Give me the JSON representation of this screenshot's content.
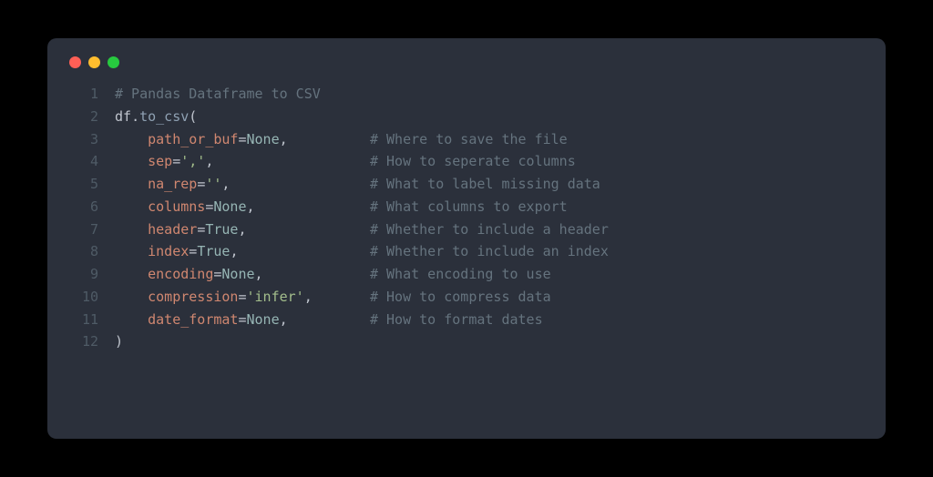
{
  "window": {
    "controls": [
      "close",
      "minimize",
      "maximize"
    ]
  },
  "code": {
    "lines": [
      {
        "num": "1",
        "tokens": [
          {
            "cls": "tok-comment",
            "text": "# Pandas Dataframe to CSV"
          }
        ]
      },
      {
        "num": "2",
        "tokens": [
          {
            "cls": "tok-ident",
            "text": "df"
          },
          {
            "cls": "tok-punct",
            "text": "."
          },
          {
            "cls": "tok-func",
            "text": "to_csv"
          },
          {
            "cls": "tok-punct",
            "text": "("
          }
        ]
      },
      {
        "num": "3",
        "tokens": [
          {
            "cls": "tok-punct",
            "text": "    "
          },
          {
            "cls": "tok-param",
            "text": "path_or_buf"
          },
          {
            "cls": "tok-op",
            "text": "="
          },
          {
            "cls": "tok-none",
            "text": "None"
          },
          {
            "cls": "tok-punct",
            "text": ",          "
          },
          {
            "cls": "tok-comment",
            "text": "# Where to save the file"
          }
        ]
      },
      {
        "num": "4",
        "tokens": [
          {
            "cls": "tok-punct",
            "text": "    "
          },
          {
            "cls": "tok-param",
            "text": "sep"
          },
          {
            "cls": "tok-op",
            "text": "="
          },
          {
            "cls": "tok-str",
            "text": "','"
          },
          {
            "cls": "tok-punct",
            "text": ",                   "
          },
          {
            "cls": "tok-comment",
            "text": "# How to seperate columns"
          }
        ]
      },
      {
        "num": "5",
        "tokens": [
          {
            "cls": "tok-punct",
            "text": "    "
          },
          {
            "cls": "tok-param",
            "text": "na_rep"
          },
          {
            "cls": "tok-op",
            "text": "="
          },
          {
            "cls": "tok-str",
            "text": "''"
          },
          {
            "cls": "tok-punct",
            "text": ",                 "
          },
          {
            "cls": "tok-comment",
            "text": "# What to label missing data"
          }
        ]
      },
      {
        "num": "6",
        "tokens": [
          {
            "cls": "tok-punct",
            "text": "    "
          },
          {
            "cls": "tok-param",
            "text": "columns"
          },
          {
            "cls": "tok-op",
            "text": "="
          },
          {
            "cls": "tok-none",
            "text": "None"
          },
          {
            "cls": "tok-punct",
            "text": ",              "
          },
          {
            "cls": "tok-comment",
            "text": "# What columns to export"
          }
        ]
      },
      {
        "num": "7",
        "tokens": [
          {
            "cls": "tok-punct",
            "text": "    "
          },
          {
            "cls": "tok-param",
            "text": "header"
          },
          {
            "cls": "tok-op",
            "text": "="
          },
          {
            "cls": "tok-bool",
            "text": "True"
          },
          {
            "cls": "tok-punct",
            "text": ",               "
          },
          {
            "cls": "tok-comment",
            "text": "# Whether to include a header"
          }
        ]
      },
      {
        "num": "8",
        "tokens": [
          {
            "cls": "tok-punct",
            "text": "    "
          },
          {
            "cls": "tok-param",
            "text": "index"
          },
          {
            "cls": "tok-op",
            "text": "="
          },
          {
            "cls": "tok-bool",
            "text": "True"
          },
          {
            "cls": "tok-punct",
            "text": ",                "
          },
          {
            "cls": "tok-comment",
            "text": "# Whether to include an index"
          }
        ]
      },
      {
        "num": "9",
        "tokens": [
          {
            "cls": "tok-punct",
            "text": "    "
          },
          {
            "cls": "tok-param",
            "text": "encoding"
          },
          {
            "cls": "tok-op",
            "text": "="
          },
          {
            "cls": "tok-none",
            "text": "None"
          },
          {
            "cls": "tok-punct",
            "text": ",             "
          },
          {
            "cls": "tok-comment",
            "text": "# What encoding to use"
          }
        ]
      },
      {
        "num": "10",
        "tokens": [
          {
            "cls": "tok-punct",
            "text": "    "
          },
          {
            "cls": "tok-param",
            "text": "compression"
          },
          {
            "cls": "tok-op",
            "text": "="
          },
          {
            "cls": "tok-str",
            "text": "'infer'"
          },
          {
            "cls": "tok-punct",
            "text": ",       "
          },
          {
            "cls": "tok-comment",
            "text": "# How to compress data"
          }
        ]
      },
      {
        "num": "11",
        "tokens": [
          {
            "cls": "tok-punct",
            "text": "    "
          },
          {
            "cls": "tok-param",
            "text": "date_format"
          },
          {
            "cls": "tok-op",
            "text": "="
          },
          {
            "cls": "tok-none",
            "text": "None"
          },
          {
            "cls": "tok-punct",
            "text": ",          "
          },
          {
            "cls": "tok-comment",
            "text": "# How to format dates"
          }
        ]
      },
      {
        "num": "12",
        "tokens": [
          {
            "cls": "tok-punct",
            "text": ")"
          }
        ]
      }
    ]
  }
}
